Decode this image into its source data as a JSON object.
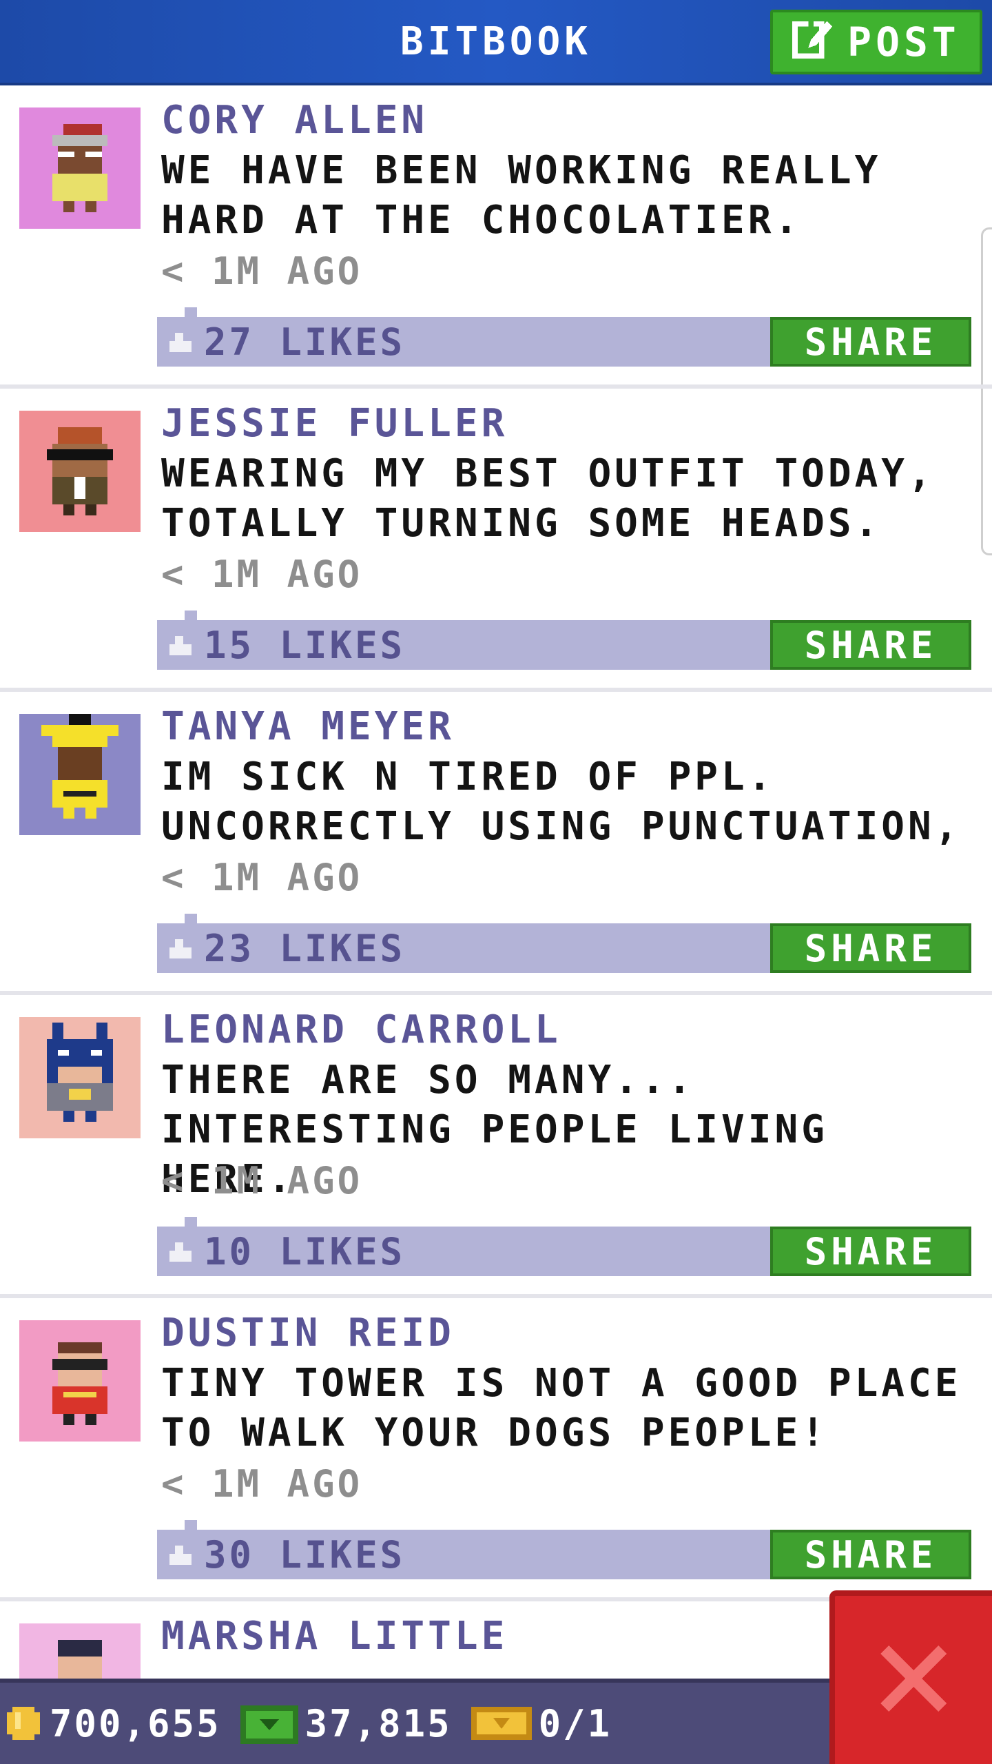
{
  "header": {
    "title": "BITBOOK",
    "post_label": "POST",
    "colors": {
      "bar": "#2459c4",
      "post_button": "#3fb22f"
    }
  },
  "posts": [
    {
      "author": "CORY ALLEN",
      "message": "WE HAVE BEEN WORKING REALLY HARD AT THE CHOCOLATIER.",
      "time": "< 1M AGO",
      "likes": "27 LIKES",
      "share_label": "SHARE",
      "avatar_bg": "#e089dd"
    },
    {
      "author": "JESSIE FULLER",
      "message": "WEARING MY BEST OUTFIT TODAY, TOTALLY TURNING SOME HEADS.",
      "time": "< 1M AGO",
      "likes": "15 LIKES",
      "share_label": "SHARE",
      "avatar_bg": "#f08e93"
    },
    {
      "author": "TANYA MEYER",
      "message": "IM SICK N TIRED OF PPL. UNCORRECTLY USING PUNCTUATION,",
      "time": "< 1M AGO",
      "likes": "23 LIKES",
      "share_label": "SHARE",
      "avatar_bg": "#8b88c6"
    },
    {
      "author": "LEONARD CARROLL",
      "message": "THERE ARE SO MANY... INTERESTING PEOPLE LIVING HERE.",
      "time": "< 1M AGO",
      "likes": "10 LIKES",
      "share_label": "SHARE",
      "avatar_bg": "#f2b9ae"
    },
    {
      "author": "DUSTIN REID",
      "message": "TINY TOWER IS NOT A GOOD PLACE TO WALK YOUR DOGS PEOPLE!",
      "time": "< 1M AGO",
      "likes": "30 LIKES",
      "share_label": "SHARE",
      "avatar_bg": "#f29bc4"
    },
    {
      "author": "MARSHA LITTLE",
      "avatar_bg": "#f1b6e3"
    }
  ],
  "status_bar": {
    "coins": "700,655",
    "bux": "37,815",
    "tickets": "0/1"
  },
  "icons": {
    "post": "edit-icon",
    "like": "thumb-icon",
    "coin": "coin-icon",
    "bux": "bux-icon",
    "ticket": "ticket-icon",
    "close": "close-icon"
  }
}
